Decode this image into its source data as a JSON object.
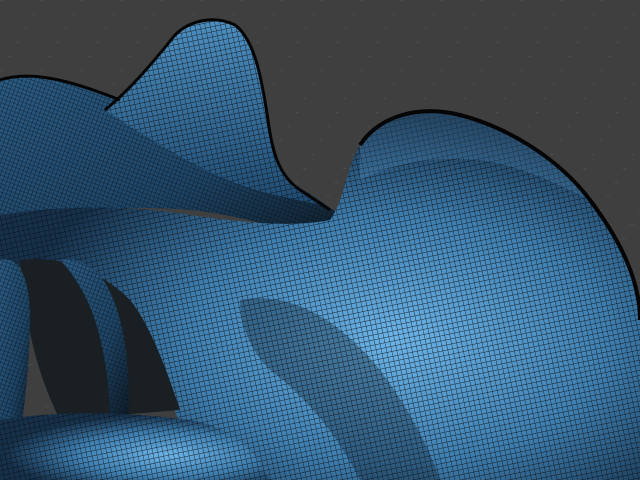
{
  "viewport": {
    "background_color": "#3f3f3f",
    "grid_dot_color": "#5a6e78",
    "mesh_fill_color": "#3f7fb0",
    "mesh_highlight_color": "#6cb4e8",
    "mesh_shadow_color": "#0d1a26",
    "wire_color": "#0a0f14"
  }
}
